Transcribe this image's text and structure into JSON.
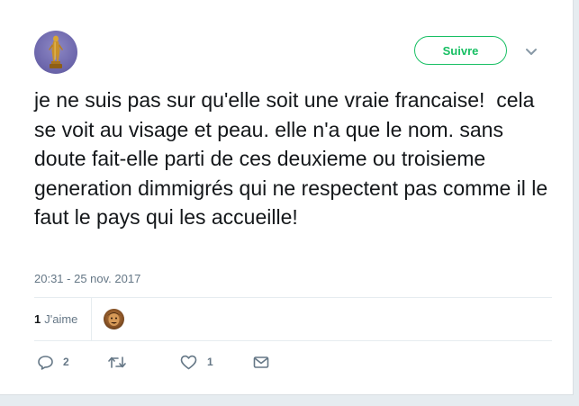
{
  "tweet": {
    "text": "je ne suis pas sur qu'elle soit une vraie francaise!  cela se voit au visage et peau. elle n'a que le nom. sans doute fait-elle parti de ces deuxieme ou troisieme generation dimmigrés qui ne respectent pas comme il le faut le pays qui les accueille!",
    "timestamp": "20:31 - 25 nov. 2017"
  },
  "header": {
    "follow_label": "Suivre"
  },
  "stats": {
    "likes_count": "1",
    "likes_label": "J'aime"
  },
  "actions": {
    "reply_count": "2",
    "like_count": "1"
  },
  "colors": {
    "accent": "#17bf63",
    "text": "#14171a",
    "muted": "#657786"
  },
  "icons": {
    "avatar": "golden-statue-avatar",
    "menu": "chevron-down-icon",
    "reply": "reply-icon",
    "retweet": "retweet-icon",
    "like": "heart-icon",
    "message": "envelope-icon"
  }
}
